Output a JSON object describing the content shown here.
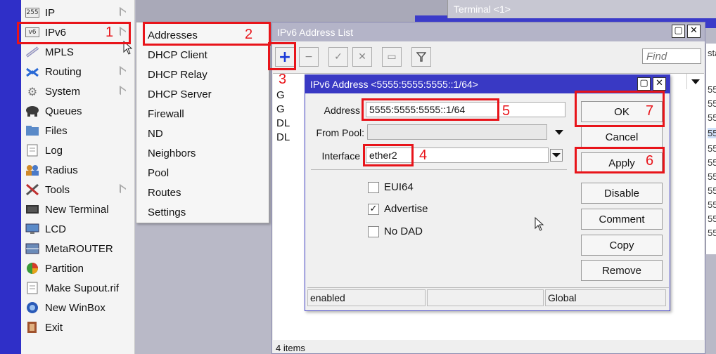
{
  "sidebar": {
    "items": [
      {
        "label": "IP",
        "icon": "ip-icon",
        "arrow": true
      },
      {
        "label": "IPv6",
        "icon": "ipv6-icon",
        "arrow": true
      },
      {
        "label": "MPLS",
        "icon": "mpls-icon",
        "arrow": false
      },
      {
        "label": "Routing",
        "icon": "routing-icon",
        "arrow": true
      },
      {
        "label": "System",
        "icon": "gear-icon",
        "arrow": true
      },
      {
        "label": "Queues",
        "icon": "queues-icon",
        "arrow": false
      },
      {
        "label": "Files",
        "icon": "folder-icon",
        "arrow": false
      },
      {
        "label": "Log",
        "icon": "log-icon",
        "arrow": false
      },
      {
        "label": "Radius",
        "icon": "users-icon",
        "arrow": false
      },
      {
        "label": "Tools",
        "icon": "tools-icon",
        "arrow": true
      },
      {
        "label": "New Terminal",
        "icon": "terminal-icon",
        "arrow": false
      },
      {
        "label": "LCD",
        "icon": "monitor-icon",
        "arrow": false
      },
      {
        "label": "MetaROUTER",
        "icon": "metarouter-icon",
        "arrow": false
      },
      {
        "label": "Partition",
        "icon": "pie-icon",
        "arrow": false
      },
      {
        "label": "Make Supout.rif",
        "icon": "document-icon",
        "arrow": false
      },
      {
        "label": "New WinBox",
        "icon": "winbox-icon",
        "arrow": false
      },
      {
        "label": "Exit",
        "icon": "exit-icon",
        "arrow": false
      }
    ],
    "ip_badge": "255",
    "ipv6_badge": "v6"
  },
  "submenu": {
    "items": [
      "Addresses",
      "DHCP Client",
      "DHCP Relay",
      "DHCP Server",
      "Firewall",
      "ND",
      "Neighbors",
      "Pool",
      "Routes",
      "Settings"
    ]
  },
  "terminal": {
    "title": "Terminal <1>"
  },
  "address_list": {
    "title": "IPv6 Address List",
    "find_placeholder": "Find",
    "flags": [
      "G",
      "G",
      "DL",
      "DL"
    ],
    "items_count": "4 items",
    "right_column_header": "sta",
    "right_column_values": [
      "55",
      "55",
      "55",
      "55",
      "55",
      "55",
      "55",
      "55",
      "55",
      "55",
      "55"
    ]
  },
  "dialog": {
    "title": "IPv6 Address <5555:5555:5555::1/64>",
    "address_label": "Address",
    "address_value": "5555:5555:5555::1/64",
    "from_pool_label": "From Pool:",
    "from_pool_value": "",
    "interface_label": "Interface",
    "interface_value": "ether2",
    "checkboxes": [
      {
        "label": "EUI64",
        "checked": false
      },
      {
        "label": "Advertise",
        "checked": true
      },
      {
        "label": "No DAD",
        "checked": false
      }
    ],
    "buttons": [
      "OK",
      "Cancel",
      "Apply",
      "Disable",
      "Comment",
      "Copy",
      "Remove"
    ],
    "status": [
      "enabled",
      "",
      "Global"
    ]
  },
  "annotations": [
    "1",
    "2",
    "3",
    "4",
    "5",
    "6",
    "7"
  ],
  "colors": {
    "annotation": "#e8141a",
    "title_active": "#3939c4",
    "strip": "#2f2fc8"
  }
}
